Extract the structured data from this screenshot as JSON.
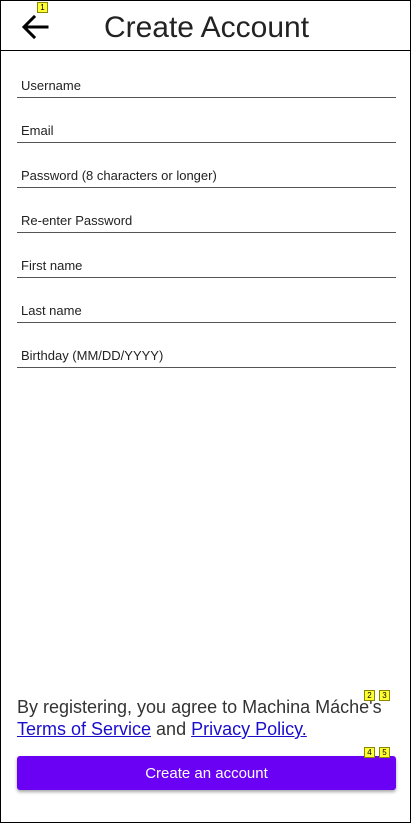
{
  "header": {
    "title": "Create Account",
    "back_icon": "arrow-left-icon"
  },
  "form": {
    "fields": [
      {
        "name": "username-field",
        "placeholder": "Username",
        "value": ""
      },
      {
        "name": "email-field",
        "placeholder": "Email",
        "value": ""
      },
      {
        "name": "password-field",
        "placeholder": "Password (8 characters or longer)",
        "value": ""
      },
      {
        "name": "reenter-password-field",
        "placeholder": "Re-enter Password",
        "value": ""
      },
      {
        "name": "first-name-field",
        "placeholder": "First name",
        "value": ""
      },
      {
        "name": "last-name-field",
        "placeholder": "Last name",
        "value": ""
      },
      {
        "name": "birthday-field",
        "placeholder": "Birthday (MM/DD/YYYY)",
        "value": ""
      }
    ]
  },
  "terms": {
    "prefix": "By registering, you agree to Machina Máche's",
    "tos_label": "Terms of Service",
    "and_text": " and ",
    "privacy_label": "Privacy Policy."
  },
  "submit": {
    "label": "Create an account"
  },
  "badges": [
    "1",
    "2",
    "3",
    "4",
    "5"
  ],
  "colors": {
    "accent": "#6a00f4",
    "link": "#1a0dcc",
    "badge": "#ffff33"
  }
}
